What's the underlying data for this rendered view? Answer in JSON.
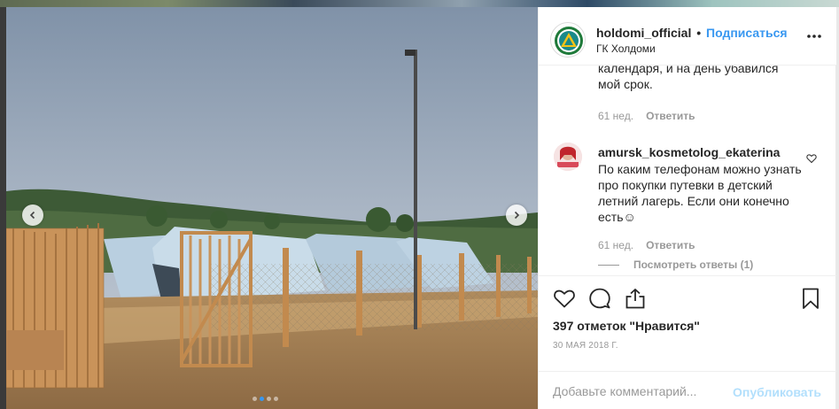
{
  "post": {
    "username": "holdomi_official",
    "separator": "•",
    "follow_label": "Подписаться",
    "location": "ГК Холдоми"
  },
  "comments": {
    "clipped_text": "календаря, и на день убавился мой срок.",
    "clipped_time": "61 нед.",
    "reply_label": "Ответить",
    "items": [
      {
        "username": "amursk_kosmetolog_ekaterina",
        "text": "По каким телефонам можно узнать про покупки путевки в детский летний лагерь. Если они конечно есть☺",
        "time": "61 нед.",
        "reply_label": "Ответить",
        "view_replies": "Посмотреть ответы (1)"
      }
    ]
  },
  "stats": {
    "likes": "397 отметок \"Нравится\"",
    "date": "30 МАЯ 2018 Г."
  },
  "composer": {
    "placeholder": "Добавьте комментарий...",
    "post_label": "Опубликовать"
  },
  "carousel": {
    "slide_count": 4,
    "active_index": 1
  },
  "colors": {
    "link": "#3897f0",
    "post_disabled": "#b2dffc",
    "muted": "#999999"
  }
}
